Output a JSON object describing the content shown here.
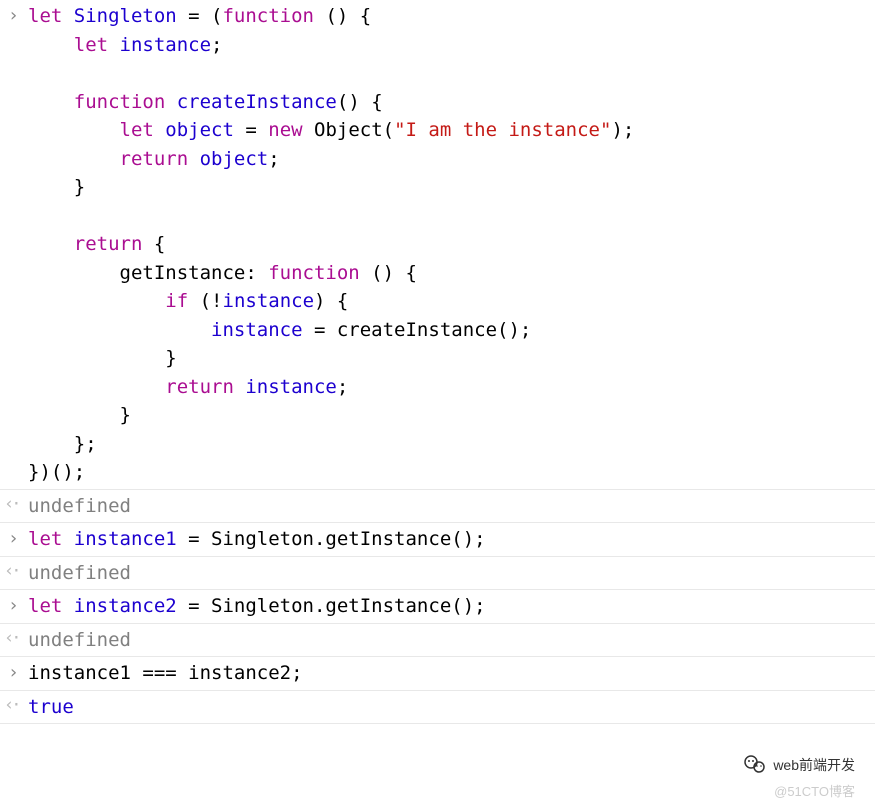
{
  "entries": [
    {
      "type": "input",
      "tokens": [
        {
          "t": "let ",
          "c": "kw"
        },
        {
          "t": "Singleton",
          "c": "var"
        },
        {
          "t": " = (",
          "c": "punc"
        },
        {
          "t": "function ",
          "c": "kw"
        },
        {
          "t": "() {\n",
          "c": "punc"
        },
        {
          "t": "    ",
          "c": "punc"
        },
        {
          "t": "let ",
          "c": "kw"
        },
        {
          "t": "instance",
          "c": "var"
        },
        {
          "t": ";\n\n",
          "c": "punc"
        },
        {
          "t": "    ",
          "c": "punc"
        },
        {
          "t": "function ",
          "c": "kw"
        },
        {
          "t": "createInstance",
          "c": "var"
        },
        {
          "t": "() {\n",
          "c": "punc"
        },
        {
          "t": "        ",
          "c": "punc"
        },
        {
          "t": "let ",
          "c": "kw"
        },
        {
          "t": "object",
          "c": "var"
        },
        {
          "t": " = ",
          "c": "punc"
        },
        {
          "t": "new ",
          "c": "kw"
        },
        {
          "t": "Object(",
          "c": "punc"
        },
        {
          "t": "\"I am the instance\"",
          "c": "str"
        },
        {
          "t": ");\n",
          "c": "punc"
        },
        {
          "t": "        ",
          "c": "punc"
        },
        {
          "t": "return ",
          "c": "kw"
        },
        {
          "t": "object",
          "c": "var"
        },
        {
          "t": ";\n",
          "c": "punc"
        },
        {
          "t": "    }\n\n",
          "c": "punc"
        },
        {
          "t": "    ",
          "c": "punc"
        },
        {
          "t": "return ",
          "c": "kw"
        },
        {
          "t": "{\n",
          "c": "punc"
        },
        {
          "t": "        getInstance: ",
          "c": "punc"
        },
        {
          "t": "function ",
          "c": "kw"
        },
        {
          "t": "() {\n",
          "c": "punc"
        },
        {
          "t": "            ",
          "c": "punc"
        },
        {
          "t": "if ",
          "c": "kw"
        },
        {
          "t": "(!",
          "c": "punc"
        },
        {
          "t": "instance",
          "c": "var"
        },
        {
          "t": ") {\n",
          "c": "punc"
        },
        {
          "t": "                ",
          "c": "punc"
        },
        {
          "t": "instance",
          "c": "var"
        },
        {
          "t": " = createInstance();\n",
          "c": "punc"
        },
        {
          "t": "            }\n",
          "c": "punc"
        },
        {
          "t": "            ",
          "c": "punc"
        },
        {
          "t": "return ",
          "c": "kw"
        },
        {
          "t": "instance",
          "c": "var"
        },
        {
          "t": ";\n",
          "c": "punc"
        },
        {
          "t": "        }\n",
          "c": "punc"
        },
        {
          "t": "    };\n",
          "c": "punc"
        },
        {
          "t": "})();",
          "c": "punc"
        }
      ]
    },
    {
      "type": "output",
      "tokens": [
        {
          "t": "undefined",
          "c": "undefined"
        }
      ]
    },
    {
      "type": "input",
      "tokens": [
        {
          "t": "let ",
          "c": "kw"
        },
        {
          "t": "instance1",
          "c": "var"
        },
        {
          "t": " = Singleton.getInstance();",
          "c": "punc"
        }
      ]
    },
    {
      "type": "output",
      "tokens": [
        {
          "t": "undefined",
          "c": "undefined"
        }
      ]
    },
    {
      "type": "input",
      "tokens": [
        {
          "t": "let ",
          "c": "kw"
        },
        {
          "t": "instance2",
          "c": "var"
        },
        {
          "t": " = Singleton.getInstance();",
          "c": "punc"
        }
      ]
    },
    {
      "type": "output",
      "tokens": [
        {
          "t": "undefined",
          "c": "undefined"
        }
      ]
    },
    {
      "type": "input",
      "tokens": [
        {
          "t": "instance1 ",
          "c": "punc"
        },
        {
          "t": "===",
          "c": "punc"
        },
        {
          "t": " instance2;",
          "c": "punc"
        }
      ]
    },
    {
      "type": "output",
      "tokens": [
        {
          "t": "true",
          "c": "true"
        }
      ]
    }
  ],
  "footer": {
    "wechat_label": "web前端开发",
    "watermark": "@51CTO博客"
  }
}
